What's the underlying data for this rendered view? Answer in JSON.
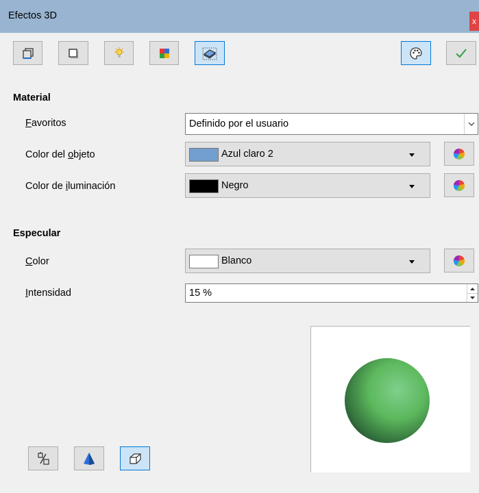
{
  "window": {
    "title": "Efectos 3D",
    "close_glyph": "x"
  },
  "toolbar": {
    "buttons": [
      {
        "name": "geometry-icon"
      },
      {
        "name": "shading-icon"
      },
      {
        "name": "illumination-icon"
      },
      {
        "name": "textures-icon"
      },
      {
        "name": "material-icon",
        "active": true
      }
    ],
    "assign_icon": "palette-icon",
    "apply_icon": "check-icon"
  },
  "material": {
    "heading": "Material",
    "favorites": {
      "label_pre": "",
      "label_ul": "F",
      "label_post": "avoritos",
      "value": "Definido por el usuario"
    },
    "object_color": {
      "label_pre": "Color del ",
      "label_ul": "o",
      "label_post": "bjeto",
      "value": "Azul claro 2",
      "swatch": "#729fcf"
    },
    "illumination_color": {
      "label_pre": "Color de ",
      "label_ul": "i",
      "label_post": "luminación",
      "value": "Negro",
      "swatch": "#000000"
    }
  },
  "specular": {
    "heading": "Especular",
    "color": {
      "label_pre": "",
      "label_ul": "C",
      "label_post": "olor",
      "value": "Blanco",
      "swatch": "#ffffff"
    },
    "intensity": {
      "label_pre": "",
      "label_ul": "I",
      "label_post": "ntensidad",
      "value": "15 %"
    }
  },
  "preview": {
    "sphere_color": "#5cb85c"
  },
  "bottom_buttons": [
    {
      "name": "convert-to-3d-icon"
    },
    {
      "name": "lathe-object-icon"
    },
    {
      "name": "perspective-icon",
      "active": true
    }
  ]
}
